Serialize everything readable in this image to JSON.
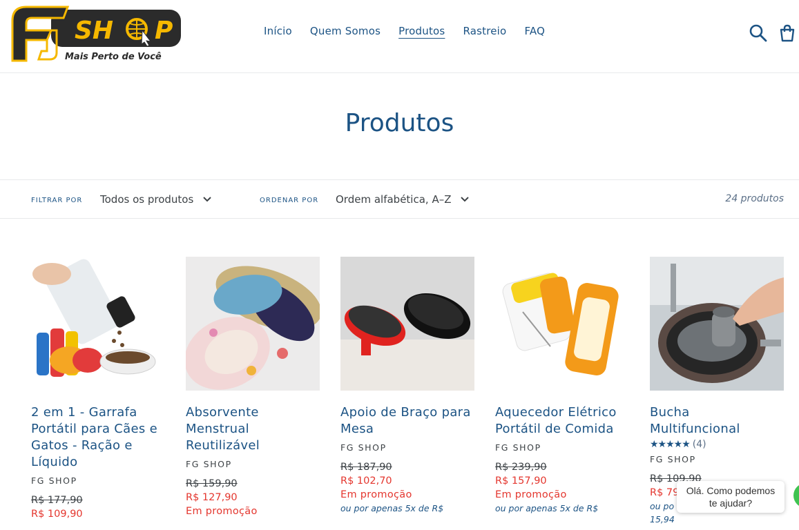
{
  "brand": {
    "logo_text": "FG SHOP",
    "tagline": "Mais Perto de Você"
  },
  "nav": [
    {
      "label": "Início"
    },
    {
      "label": "Quem Somos"
    },
    {
      "label": "Produtos",
      "active": true
    },
    {
      "label": "Rastreio"
    },
    {
      "label": "FAQ"
    }
  ],
  "page_title": "Produtos",
  "filters": {
    "filter_label": "FILTRAR POR",
    "filter_value": "Todos os produtos",
    "sort_label": "ORDENAR POR",
    "sort_value": "Ordem alfabética, A–Z",
    "count": "24 produtos"
  },
  "products": [
    {
      "title": "2 em 1 - Garrafa Portátil para Cães e Gatos - Ração e Líquido",
      "vendor": "FG SHOP",
      "old_price": "R$ 177,90",
      "price": "R$ 109,90"
    },
    {
      "title": "Absorvente Menstrual Reutilizável",
      "vendor": "FG SHOP",
      "old_price": "R$ 159,90",
      "price": "R$ 127,90",
      "promo": "Em promoção"
    },
    {
      "title": "Apoio de Braço para Mesa",
      "vendor": "FG SHOP",
      "old_price": "R$ 187,90",
      "price": "R$ 102,70",
      "promo": "Em promoção",
      "installments": "ou por apenas 5x de R$"
    },
    {
      "title": "Aquecedor Elétrico Portátil de Comida",
      "vendor": "FG SHOP",
      "old_price": "R$ 239,90",
      "price": "R$ 157,90",
      "promo": "Em promoção",
      "installments": "ou por apenas 5x de R$"
    },
    {
      "title": "Bucha Multifuncional",
      "vendor": "FG SHOP",
      "rating": 5,
      "rating_count": "(4)",
      "old_price": "R$ 109,90",
      "price": "R$ 79",
      "installments": "ou po",
      "installment_value": "15,94"
    }
  ],
  "chat": {
    "line1": "Olá. Como podemos",
    "line2": "te ajudar?"
  },
  "colors": {
    "primary": "#1c5384",
    "sale": "#e4362e",
    "logo_yellow": "#f5b800"
  },
  "icons": [
    "search-icon",
    "cart-icon",
    "chevron-down-icon",
    "star-icon",
    "whatsapp-icon"
  ]
}
